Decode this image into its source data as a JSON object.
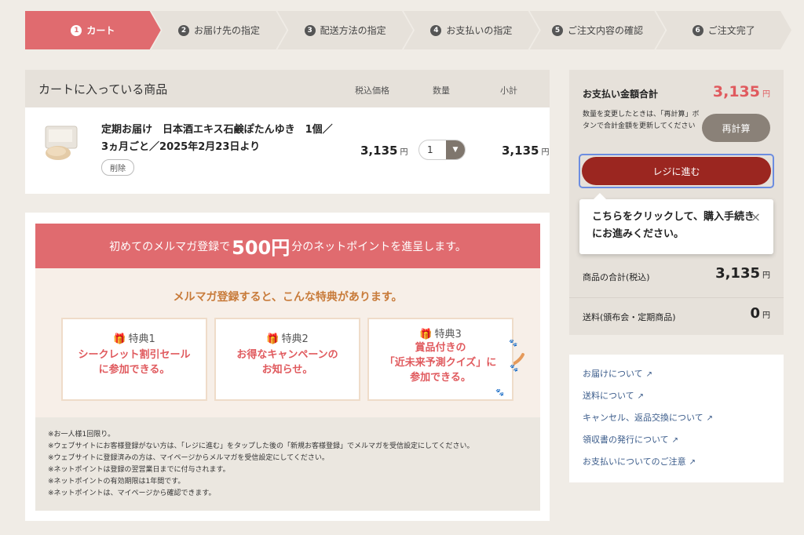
{
  "steps": [
    {
      "num": "1",
      "label": "カート",
      "active": true
    },
    {
      "num": "2",
      "label": "お届け先の指定"
    },
    {
      "num": "3",
      "label": "配送方法の指定"
    },
    {
      "num": "4",
      "label": "お支払いの指定"
    },
    {
      "num": "5",
      "label": "ご注文内容の確認"
    },
    {
      "num": "6",
      "label": "ご注文完了"
    }
  ],
  "cart": {
    "title": "カートに入っている商品",
    "col_price": "税込価格",
    "col_qty": "数量",
    "col_subtotal": "小計",
    "item": {
      "name": "定期お届け　日本酒エキス石鹸ぽたんゆき　1個／3ヵ月ごと／2025年2月23日より",
      "delete": "削除",
      "price": "3,135",
      "qty": "1",
      "subtotal": "3,135",
      "yen": "円"
    }
  },
  "promo": {
    "banner_pre": "初めてのメルマガ登録で",
    "banner_amount": "500円",
    "banner_post": "分のネットポイントを進呈します。",
    "subtitle": "メルマガ登録すると、こんな特典があります。",
    "benefits": [
      {
        "title": "特典1",
        "body_l1": "シークレット割引セール",
        "body_l2": "に参加できる。"
      },
      {
        "title": "特典2",
        "body_l1": "お得なキャンペーンの",
        "body_l2": "お知らせ。"
      },
      {
        "title": "特典3",
        "body_l1": "賞品付きの",
        "body_l2": "「近未来予測クイズ」に",
        "body_l3": "参加できる。"
      }
    ],
    "notes": [
      "※お一人様1回限り。",
      "※ウェブサイトにお客様登録がない方は、「レジに進む」をタップした後の「新規お客様登録」でメルマガを受信設定にしてください。",
      "※ウェブサイトに登録済みの方は、マイページからメルマガを受信設定にしてください。",
      "※ネットポイントは登録の翌営業日までに付与されます。",
      "※ネットポイントの有効期限は1年間です。",
      "※ネットポイントは、マイページから確認できます。"
    ]
  },
  "summary": {
    "title": "お支払い金額合計",
    "total": "3,135",
    "yen": "円",
    "note": "数量を変更したときは、「再計算」ボタンで合計金額を更新してください",
    "recalc": "再計算",
    "checkout": "レジに進む",
    "tooltip": "こちらをクリックして、購入手続きにお進みください。",
    "tooltip_close": "×",
    "lines": [
      {
        "label": "商品の合計(税込)",
        "value": "3,135"
      },
      {
        "label": "送料(頒布会・定期商品)",
        "value": "0"
      }
    ]
  },
  "links": [
    "お届けについて",
    "送料について",
    "キャンセル、返品交換について",
    "領収書の発行について",
    "お支払いについてのご注意"
  ],
  "colors": {
    "accent": "#e06b6f",
    "checkout": "#9b2620",
    "link": "#3a5b8a"
  }
}
